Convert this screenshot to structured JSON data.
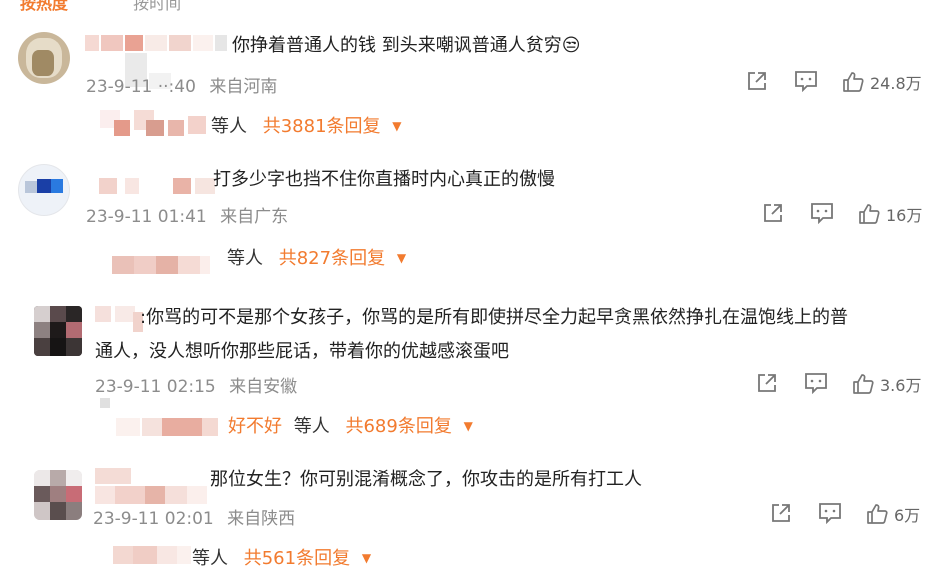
{
  "header": {
    "highlight": "按热度",
    "other": "按时间"
  },
  "comments": [
    {
      "text_line1": "你挣着普通人的钱 到头来嘲讽普通人贫穷😒",
      "text_line2": "",
      "time": "23-9-11 ··:40",
      "location": "来自河南",
      "likes": "24.8万",
      "reply_prefix": "",
      "reply_deng": "等人",
      "reply_count": "共3881条回复"
    },
    {
      "text_line1": "打多少字也挡不住你直播时内心真正的傲慢",
      "text_line2": "",
      "time": "23-9-11 01:41",
      "location": "来自广东",
      "likes": "16万",
      "reply_prefix": "",
      "reply_deng": "等人",
      "reply_count": "共827条回复"
    },
    {
      "text_line1": ":你骂的可不是那个女孩子，你骂的是所有即使拼尽全力起早贪黑依然挣扎在温饱线上的普",
      "text_line2": "通人，没人想听你那些屁话，带着你的优越感滚蛋吧",
      "time": "23-9-11 02:15",
      "location": "来自安徽",
      "likes": "3.6万",
      "reply_prefix": "好不好",
      "reply_deng": "等人",
      "reply_count": "共689条回复"
    },
    {
      "text_line1": "那位女生？你可别混淆概念了，你攻击的是所有打工人",
      "text_line2": "",
      "time": "23-9-11 02:01",
      "location": "来自陕西",
      "likes": "6万",
      "reply_prefix": "",
      "reply_deng": "等人",
      "reply_count": "共561条回复"
    }
  ],
  "icons": {
    "share": "share-icon",
    "comment": "comment-icon",
    "like": "like-icon",
    "expand": "chevron-down-icon"
  },
  "colors": {
    "accent": "#f27b2f",
    "meta": "#8c8c8c",
    "text": "#222222"
  }
}
